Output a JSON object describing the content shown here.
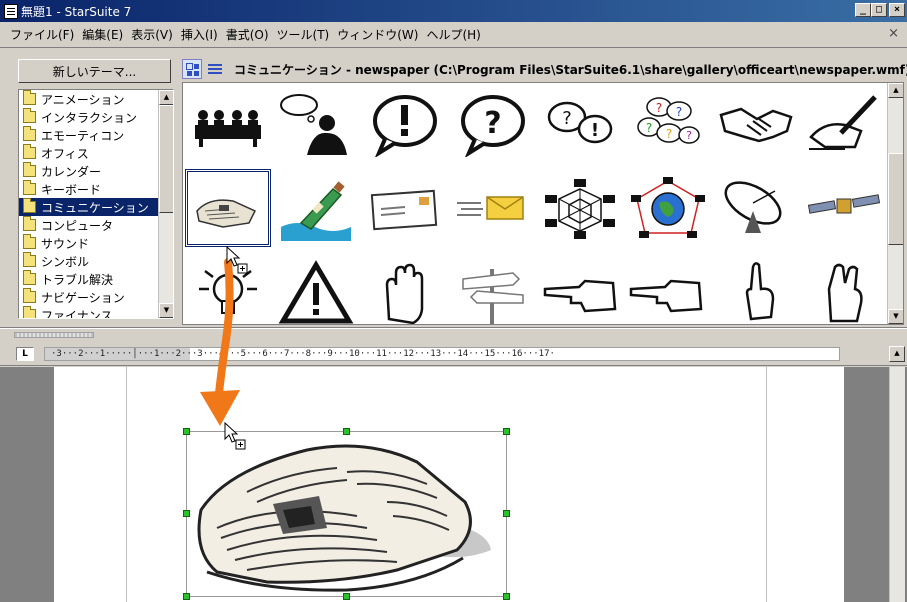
{
  "window": {
    "title": "無題1 - StarSuite 7",
    "controls": {
      "minimize": "_",
      "maximize": "□",
      "close": "×"
    },
    "doc_close": "×"
  },
  "menubar": {
    "items": [
      "ファイル(F)",
      "編集(E)",
      "表示(V)",
      "挿入(I)",
      "書式(O)",
      "ツール(T)",
      "ウィンドウ(W)",
      "ヘルプ(H)"
    ]
  },
  "gallery": {
    "new_theme_button": "新しいテーマ...",
    "path_label": "コミュニケーション - newspaper (C:\\Program Files\\StarSuite6.1\\share\\gallery\\officeart\\newspaper.wmf)",
    "themes": [
      "アニメーション",
      "インタラクション",
      "エモーティコン",
      "オフィス",
      "カレンダー",
      "キーボード",
      "コミュニケーション",
      "コンピュータ",
      "サウンド",
      "シンボル",
      "トラブル解決",
      "ナビゲーション",
      "ファイナンス"
    ],
    "selected_theme_index": 6,
    "clipart": [
      "meeting-table",
      "thinking-person",
      "exclamation-bubble",
      "question-bubble",
      "question-exclamation-bubbles",
      "colorful-question-bubbles",
      "handshake",
      "writing-hand",
      "newspaper",
      "message-in-bottle",
      "envelope-letter",
      "flying-envelope",
      "network-web",
      "globe-network",
      "satellite-dish",
      "satellite",
      "light-bulb",
      "warning-sign",
      "raised-hand",
      "signpost",
      "pointing-hand-left",
      "pointing-hand-left-2",
      "finger-up",
      "crossed-fingers"
    ],
    "selected_clipart": "newspaper"
  },
  "ruler": {
    "corner_label": "L",
    "text": "·3···2···1·····│···1···2···3···4···5···6···7···8···9···10···11···12···13···14···15···16···17·"
  },
  "colors": {
    "title_bar": "#0a246a",
    "selection": "#0a246a",
    "drag_arrow": "#f07818",
    "handle": "#2ec02e"
  }
}
